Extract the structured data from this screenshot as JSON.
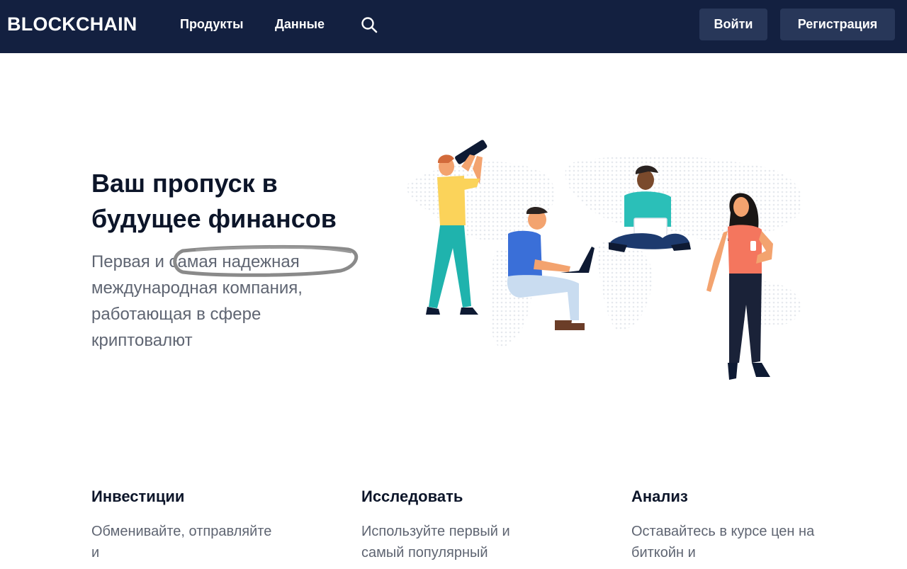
{
  "header": {
    "logo": "BLOCKCHAIN",
    "nav": [
      "Продукты",
      "Данные"
    ],
    "search_icon": "search-icon",
    "login_label": "Войти",
    "signup_label": "Регистрация"
  },
  "hero": {
    "title_line1": "Ваш пропуск в",
    "title_line2": "будущее финансов",
    "subtitle": "Первая и самая надежная международная компания, работающая в сфере криптовалют"
  },
  "features": [
    {
      "title": "Инвестиции",
      "text": "Обменивайте, отправляйте и"
    },
    {
      "title": "Исследовать",
      "text": "Используйте первый и самый популярный"
    },
    {
      "title": "Анализ",
      "text": "Оставайтесь в курсе цен на биткойн и"
    }
  ],
  "colors": {
    "header_bg": "#132040",
    "button_bg": "#283759",
    "text_dark": "#0c1529",
    "text_muted": "#5f6572"
  }
}
